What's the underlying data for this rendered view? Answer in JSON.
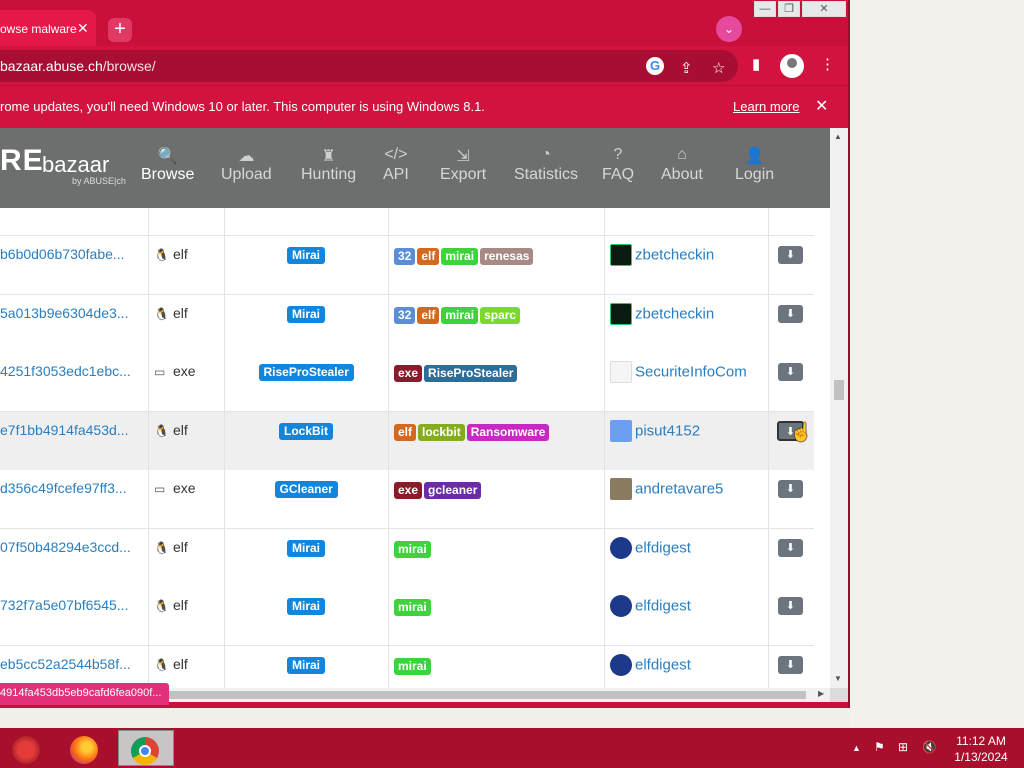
{
  "browser": {
    "tab_title": "owse malware",
    "tab_close": "✕",
    "new_tab": "+",
    "url_host": "bazaar.abuse.ch",
    "url_path": "/browse/",
    "window_controls": {
      "minimize": "—",
      "maximize": "❐",
      "close": "✕"
    }
  },
  "infobar": {
    "message": "rome updates, you'll need Windows 10 or later. This computer is using Windows 8.1.",
    "learn_more": "Learn more",
    "close": "✕"
  },
  "site": {
    "logo_main": "RE",
    "logo_bazaar": "bazaar",
    "logo_by": "by ABUSE|ch",
    "nav": [
      {
        "label": "Browse",
        "icon": "search-icon",
        "glyph": "🔍"
      },
      {
        "label": "Upload",
        "icon": "cloud-upload-icon",
        "glyph": "☁"
      },
      {
        "label": "Hunting",
        "icon": "castle-icon",
        "glyph": "♜"
      },
      {
        "label": "API",
        "icon": "code-icon",
        "glyph": "</>"
      },
      {
        "label": "Export",
        "icon": "export-icon",
        "glyph": "⇲"
      },
      {
        "label": "Statistics",
        "icon": "pie-chart-icon",
        "glyph": "◔"
      },
      {
        "label": "FAQ",
        "icon": "question-icon",
        "glyph": "?"
      },
      {
        "label": "About",
        "icon": "building-icon",
        "glyph": "⌂"
      },
      {
        "label": "Login",
        "icon": "user-icon",
        "glyph": "👤"
      }
    ]
  },
  "rows": [
    {
      "hash": "b6b0d06b730fabe...",
      "type": "elf",
      "signature": "Mirai",
      "tags": [
        {
          "t": "32",
          "c": "#5b8ed6"
        },
        {
          "t": "elf",
          "c": "#d2691e"
        },
        {
          "t": "mirai",
          "c": "#3cd33c"
        },
        {
          "t": "renesas",
          "c": "#a78a84"
        }
      ],
      "reporter": "zbetcheckin",
      "avatar": "dark"
    },
    {
      "hash": "5a013b9e6304de3...",
      "type": "elf",
      "signature": "Mirai",
      "tags": [
        {
          "t": "32",
          "c": "#5b8ed6"
        },
        {
          "t": "elf",
          "c": "#d2691e"
        },
        {
          "t": "mirai",
          "c": "#3cd33c"
        },
        {
          "t": "sparc",
          "c": "#7cd92a"
        }
      ],
      "reporter": "zbetcheckin",
      "avatar": "dark"
    },
    {
      "hash": "4251f3053edc1ebc...",
      "type": "exe",
      "signature": "RiseProStealer",
      "tags": [
        {
          "t": "exe",
          "c": "#8b1a2b"
        },
        {
          "t": "RiseProStealer",
          "c": "#2f6d99"
        }
      ],
      "reporter": "SecuriteInfoCom",
      "avatar": "light"
    },
    {
      "hash": "e7f1bb4914fa453d...",
      "type": "elf",
      "signature": "LockBit",
      "tags": [
        {
          "t": "elf",
          "c": "#d2691e"
        },
        {
          "t": "lockbit",
          "c": "#84ac1e"
        },
        {
          "t": "Ransomware",
          "c": "#c72ac2"
        }
      ],
      "reporter": "pisut4152",
      "avatar": "blue"
    },
    {
      "hash": "d356c49fcefe97ff3...",
      "type": "exe",
      "signature": "GCleaner",
      "tags": [
        {
          "t": "exe",
          "c": "#8b1a2b"
        },
        {
          "t": "gcleaner",
          "c": "#6a2ca8"
        }
      ],
      "reporter": "andretavare5",
      "avatar": "photo"
    },
    {
      "hash": "07f50b48294e3ccd...",
      "type": "elf",
      "signature": "Mirai",
      "tags": [
        {
          "t": "mirai",
          "c": "#3cd33c"
        }
      ],
      "reporter": "elfdigest",
      "avatar": "eye"
    },
    {
      "hash": "732f7a5e07bf6545...",
      "type": "elf",
      "signature": "Mirai",
      "tags": [
        {
          "t": "mirai",
          "c": "#3cd33c"
        }
      ],
      "reporter": "elfdigest",
      "avatar": "eye"
    },
    {
      "hash": "eb5cc52a2544b58f...",
      "type": "elf",
      "signature": "Mirai",
      "tags": [
        {
          "t": "mirai",
          "c": "#3cd33c"
        }
      ],
      "reporter": "elfdigest",
      "avatar": "eye"
    }
  ],
  "status_url": "4914fa453db5eb9cafd6fea090f...",
  "taskbar": {
    "time": "11:12 AM",
    "date": "1/13/2024"
  }
}
